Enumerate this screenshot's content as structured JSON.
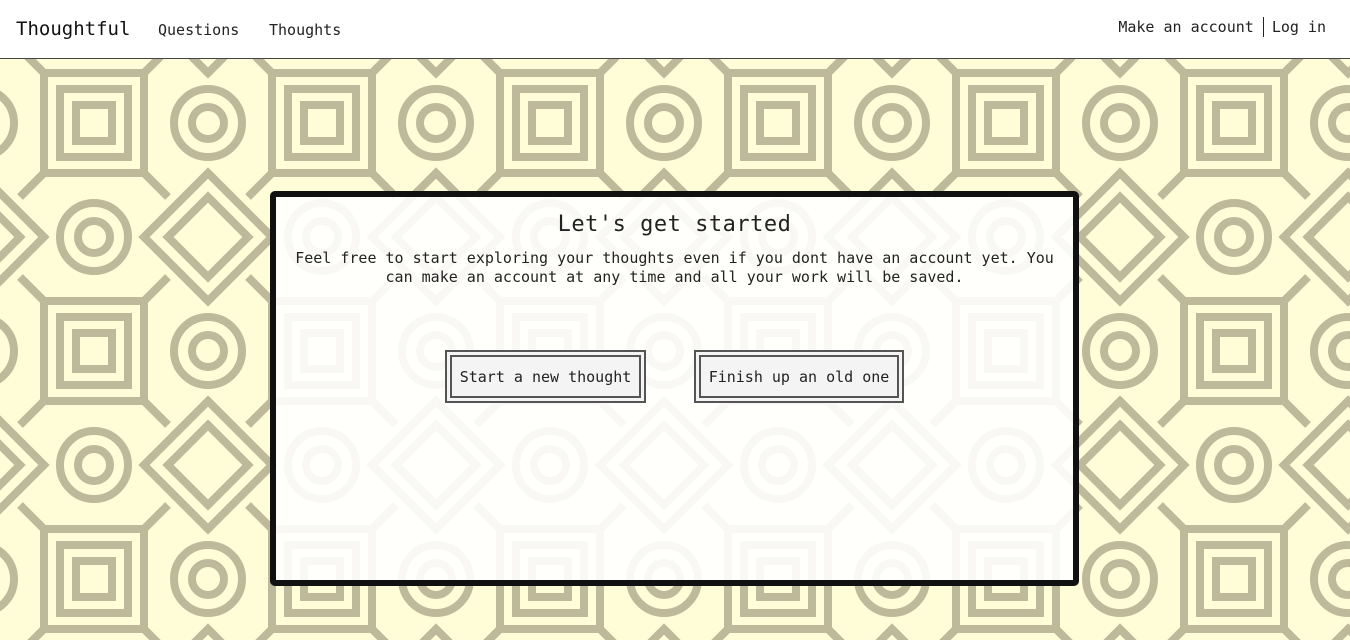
{
  "header": {
    "brand": "Thoughtful",
    "nav": [
      {
        "label": "Questions"
      },
      {
        "label": "Thoughts"
      }
    ],
    "auth": {
      "signup_label": "Make an account",
      "login_label": "Log in"
    }
  },
  "main": {
    "title": "Let's get started",
    "intro": "Feel free to start exploring your thoughts even if you dont have an account yet. You can make an account at any time and all your work will be saved.",
    "buttons": {
      "new_thought": "Start a new thought",
      "old_thought": "Finish up an old one"
    }
  },
  "colors": {
    "background": "#fffcd8",
    "pattern": "#bdb99a",
    "card_border": "#111111"
  }
}
